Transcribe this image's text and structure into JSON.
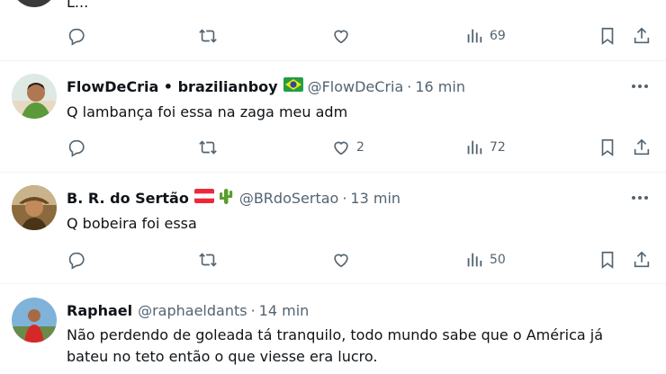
{
  "posts": [
    {
      "truncated_text": "L...",
      "stats": {
        "views": "69"
      }
    },
    {
      "display_name": "FlowDeCria • brazilianboy",
      "handle": "@FlowDeCria",
      "separator": "·",
      "time": "16 min",
      "text": "Q lambança foi essa na zaga meu adm",
      "stats": {
        "likes": "2",
        "views": "72"
      }
    },
    {
      "display_name": "B. R. do Sertão",
      "handle": "@BRdoSertao",
      "separator": "·",
      "time": "13 min",
      "text": "Q bobeira foi essa",
      "stats": {
        "views": "50"
      }
    },
    {
      "display_name": "Raphael",
      "handle": "@raphaeldants",
      "separator": "·",
      "time": "14 min",
      "text_line1": "Não perdendo de goleada tá tranquilo, todo mundo sabe que o América já",
      "text_line2": "bateu no teto então o que viesse era lucro."
    }
  ],
  "icons": [
    "reply-icon",
    "retweet-icon",
    "like-icon",
    "views-icon",
    "bookmark-icon",
    "share-icon",
    "more-icon"
  ],
  "colors": {
    "text": "#0f1419",
    "secondary": "#536471",
    "divider": "#eff3f4"
  }
}
